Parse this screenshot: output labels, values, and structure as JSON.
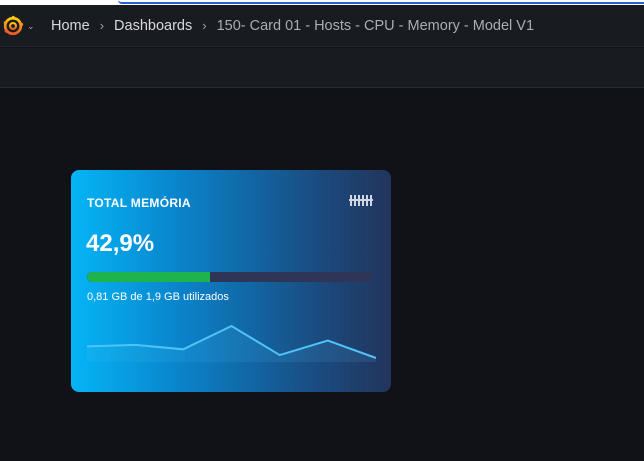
{
  "header": {
    "logo": "grafana-logo-icon",
    "breadcrumb": {
      "home": "Home",
      "dashboards": "Dashboards",
      "current": "150- Card 01 - Hosts - CPU - Memory - Model V1"
    }
  },
  "card": {
    "title": "TOTAL MEMÓRIA",
    "icon": "memory-chip-icon",
    "value": "42,9%",
    "progress_percent": 42.9,
    "subtitle": "0,81 GB de 1,9 GB utilizados",
    "colors": {
      "gradient_start": "#04b5f6",
      "gradient_end": "#22345c",
      "progress_fill": "#1fb34d",
      "progress_track": "#2e3556",
      "sparkline": "#4fc3f7"
    },
    "sparkline_values": [
      2,
      3,
      0,
      16,
      -4,
      6,
      -6
    ]
  }
}
